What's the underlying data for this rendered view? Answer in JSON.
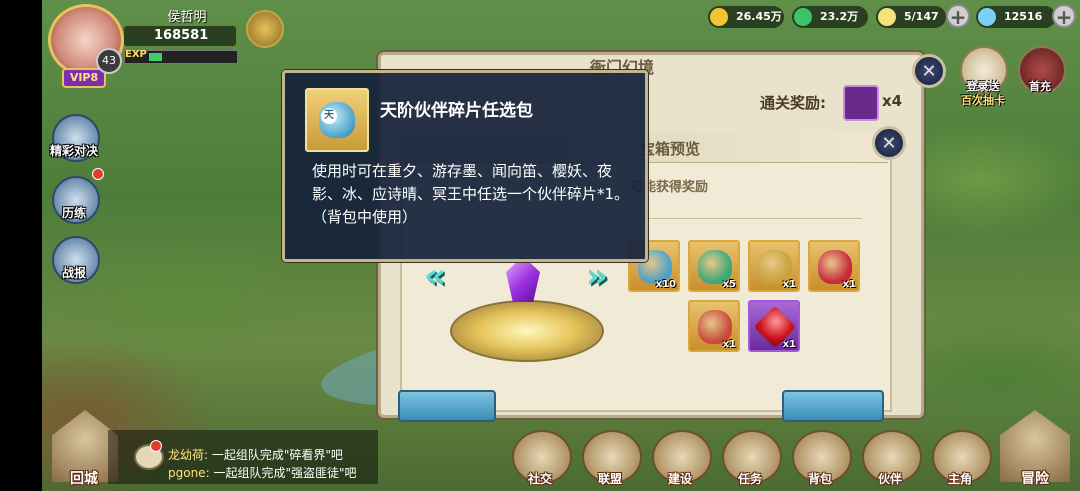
{
  "player": {
    "name": "侯哲明",
    "power": "168581",
    "vip": "VIP8",
    "level": "43",
    "exp_label": "EXP",
    "exp_fraction": 0.15
  },
  "resources": [
    {
      "name": "gold-coin-icon",
      "value": "26.45万",
      "color": "#f2c434"
    },
    {
      "name": "jade-icon",
      "value": "23.2万",
      "color": "#3cc46a"
    },
    {
      "name": "stamina-icon",
      "value": "5/147",
      "color": "#f6e27a"
    },
    {
      "name": "diamond-icon",
      "value": "12516",
      "color": "#7ad0f5"
    }
  ],
  "top_right": {
    "login_gift": "登录送",
    "login_gift_sub": "百次抽卡",
    "first_charge": "首充"
  },
  "side": {
    "arena": "精彩对决",
    "training": "历练",
    "battle_report": "战报"
  },
  "dialog": {
    "title": "衙门幻境",
    "reward_label": "通关奖励:",
    "reward_count": "x4"
  },
  "preview": {
    "title": "宝箱预览",
    "possible_rewards": "可能获得奖励",
    "items": [
      {
        "name": "partner-shard-bag",
        "count": "x10",
        "color": "#4aa2c9",
        "rarity": "gold"
      },
      {
        "name": "partner-bag-green",
        "count": "x5",
        "color": "#3aa87a",
        "rarity": "gold"
      },
      {
        "name": "gold-bag",
        "count": "x1",
        "color": "#c9a23a",
        "rarity": "gold"
      },
      {
        "name": "red-bag",
        "count": "x1",
        "color": "#c8283a",
        "rarity": "gold"
      },
      {
        "name": "red-pouch",
        "count": "x1",
        "color": "#c84a3a",
        "rarity": "gold"
      },
      {
        "name": "ruby-gem",
        "count": "x1",
        "color": "#d0141e",
        "rarity": "purple"
      }
    ]
  },
  "tooltip": {
    "item_name": "天阶伙伴碎片任选包",
    "item_tag": "天",
    "description": "使用时可在重夕、游存墨、闻向笛、樱妖、夜影、冰、应诗晴、冥王中任选一个伙伴碎片*1。（背包中使用）"
  },
  "chat": [
    {
      "who": "龙幼荷:",
      "text": "一起组队完成\"碎看界\"吧"
    },
    {
      "who": "pgone:",
      "text": "一起组队完成\"强盗匪徒\"吧"
    }
  ],
  "bottom_nav": {
    "home": "回城",
    "adventure": "冒险",
    "items": [
      "社交",
      "联盟",
      "建设",
      "任务",
      "背包",
      "伙伴",
      "主角"
    ]
  }
}
